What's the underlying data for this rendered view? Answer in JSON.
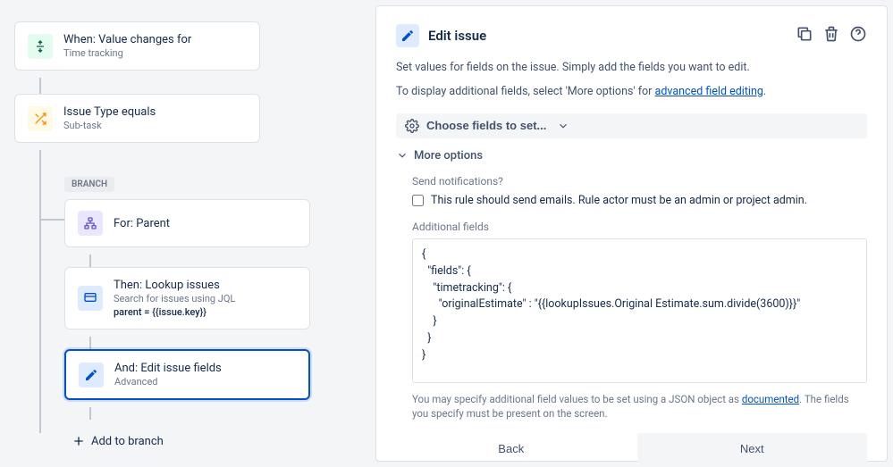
{
  "flow": {
    "trigger": {
      "title": "When: Value changes for",
      "subtitle": "Time tracking"
    },
    "condition": {
      "title": "Issue Type equals",
      "subtitle": "Sub-task"
    },
    "branch_tag": "BRANCH",
    "for_node": {
      "title": "For: Parent"
    },
    "lookup_node": {
      "title": "Then: Lookup issues",
      "subtitle": "Search for issues using JQL",
      "query": "parent = {{issue.key}}"
    },
    "edit_node": {
      "title": "And: Edit issue fields",
      "subtitle": "Advanced"
    },
    "add_branch": "Add to branch"
  },
  "panel": {
    "title": "Edit issue",
    "desc1": "Set values for fields on the issue. Simply add the fields you want to edit.",
    "desc2_pre": "To display additional fields, select 'More options' for ",
    "desc2_link": "advanced field editing",
    "desc2_post": ".",
    "choose_fields": "Choose fields to set...",
    "more_options": "More options",
    "send_q": "Send notifications?",
    "send_text": "This rule should send emails. Rule actor must be an admin or project admin.",
    "send_checked": false,
    "addl_label": "Additional fields",
    "code": "{\n  \"fields\": {\n    \"timetracking\": {\n      \"originalEstimate\" : \"{{lookupIssues.Original Estimate.sum.divide(3600)}}\"\n    }\n  }\n}",
    "help_pre": "You may specify additional field values to be set using a JSON object as ",
    "help_link": "documented",
    "help_post": ". The fields you specify must be present on the screen.",
    "back": "Back",
    "next": "Next"
  }
}
